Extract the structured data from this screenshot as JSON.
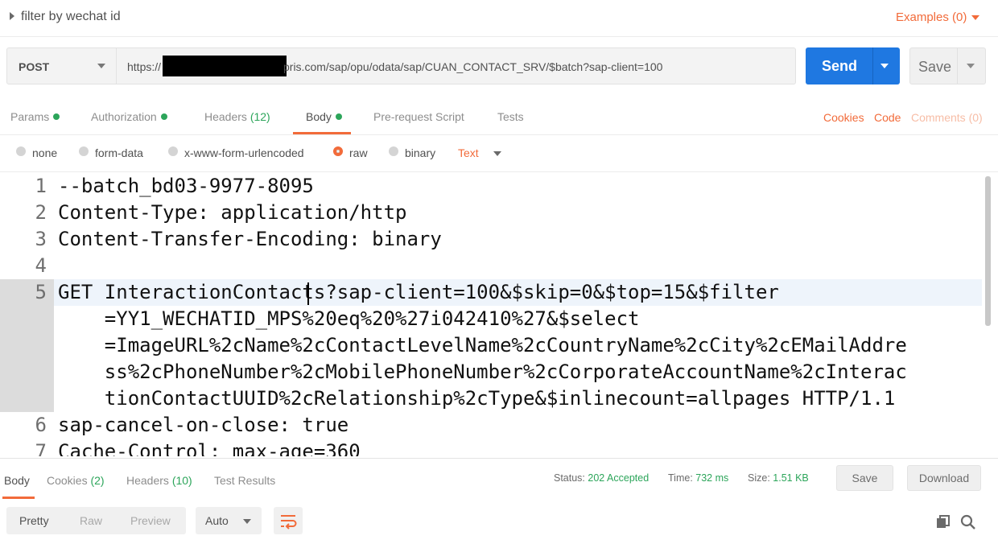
{
  "title": "filter by wechat id",
  "examples_label": "Examples (0)",
  "request": {
    "method": "POST",
    "url_prefix": "https://",
    "url_suffix": "pris.com/sap/opu/odata/sap/CUAN_CONTACT_SRV/$batch?sap-client=100",
    "send_label": "Send",
    "save_label": "Save"
  },
  "request_tabs": [
    {
      "label": "Params",
      "indicator": "dot"
    },
    {
      "label": "Authorization",
      "indicator": "dot"
    },
    {
      "label": "Headers ",
      "count": "(12)"
    },
    {
      "label": "Body",
      "indicator": "dot",
      "active": true
    },
    {
      "label": "Pre-request Script"
    },
    {
      "label": "Tests"
    }
  ],
  "request_links": {
    "cookies": "Cookies",
    "code": "Code",
    "comments": "Comments (0)"
  },
  "body_types": {
    "none": "none",
    "form_data": "form-data",
    "urlencoded": "x-www-form-urlencoded",
    "raw": "raw",
    "binary": "binary",
    "selected": "raw",
    "text_type": "Text"
  },
  "editor": {
    "lines": [
      {
        "n": "1",
        "text": "--batch_bd03-9977-8095"
      },
      {
        "n": "2",
        "text": "Content-Type: application/http"
      },
      {
        "n": "3",
        "text": "Content-Transfer-Encoding: binary"
      },
      {
        "n": "4",
        "text": ""
      },
      {
        "n": "5",
        "text": "GET InteractionContacts?sap-client=100&$skip=0&$top=15&$filter"
      },
      {
        "n": "",
        "text": "    =YY1_WECHATID_MPS%20eq%20%27i042410%27&$select"
      },
      {
        "n": "",
        "text": "    =ImageURL%2cName%2cContactLevelName%2cCountryName%2cCity%2cEMailAddre"
      },
      {
        "n": "",
        "text": "    ss%2cPhoneNumber%2cMobilePhoneNumber%2cCorporateAccountName%2cInterac"
      },
      {
        "n": "",
        "text": "    tionContactUUID%2cRelationship%2cType&$inlinecount=allpages HTTP/1.1"
      },
      {
        "n": "6",
        "text": "sap-cancel-on-close: true"
      },
      {
        "n": "7",
        "text": "Cache-Control: max-age=360"
      }
    ]
  },
  "response": {
    "tabs": [
      {
        "label": "Body",
        "active": true
      },
      {
        "label": "Cookies ",
        "count": "(2)"
      },
      {
        "label": "Headers ",
        "count": "(10)"
      },
      {
        "label": "Test Results"
      }
    ],
    "status_label": "Status:",
    "status_value": "202 Accepted",
    "time_label": "Time:",
    "time_value": "732 ms",
    "size_label": "Size:",
    "size_value": "1.51 KB",
    "save_label": "Save",
    "download_label": "Download",
    "view_modes": [
      "Pretty",
      "Raw",
      "Preview"
    ],
    "format": "Auto"
  },
  "icons": {
    "wrap": "wrap-lines-icon",
    "copy": "copy-icon",
    "search": "search-icon"
  },
  "colors": {
    "accent": "#f26b3a",
    "send": "#1f78e1",
    "success": "#2ca55a"
  }
}
